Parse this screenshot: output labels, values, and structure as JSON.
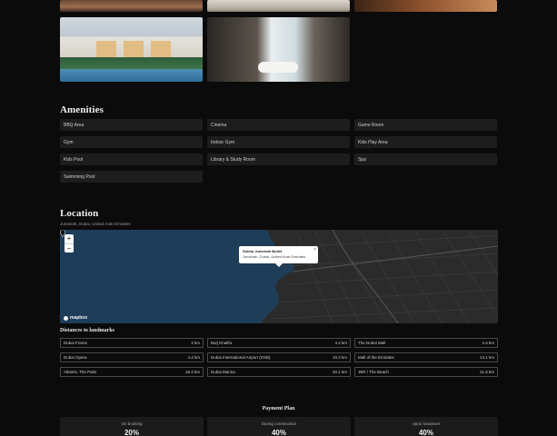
{
  "amenities": {
    "title": "Amenities",
    "items": [
      "BBQ Area",
      "Cinema",
      "Game Room",
      "Gym",
      "Indoor Gym",
      "Kids Play Area",
      "Kids Pool",
      "Library & Study Room",
      "Spa",
      "Swimming Pool"
    ]
  },
  "location": {
    "title": "Location",
    "subtitle": "Jumeirah, Dubai, United Arab Emirates",
    "map": {
      "zoom_in": "+",
      "zoom_out": "−",
      "popup_title": "Sobha Jumeirah Bullet",
      "popup_address": "Jumeirah, Dubai, United Arab Emirates",
      "popup_close": "×",
      "provider": "mapbox",
      "water_color": "#1e3d59",
      "land_color": "#2b2b2b"
    }
  },
  "distances": {
    "title": "Distances to landmarks",
    "items": [
      {
        "name": "Dubai Frame",
        "value": "3 km"
      },
      {
        "name": "Burj Khalifa",
        "value": "4.2 km"
      },
      {
        "name": "The Dubai Mall",
        "value": "4.4 km"
      },
      {
        "name": "Dubai Opera",
        "value": "4.4 km"
      },
      {
        "name": "Dubai International Airport (DXB)",
        "value": "10.3 km"
      },
      {
        "name": "Mall of the Emirates",
        "value": "14.1 km"
      },
      {
        "name": "Atlantis, The Palm",
        "value": "18.4 km"
      },
      {
        "name": "Dubai Marina",
        "value": "20.1 km"
      },
      {
        "name": "JBR / The Beach",
        "value": "21.8 km"
      }
    ]
  },
  "payment": {
    "title": "Payment Plan",
    "stages": [
      {
        "label": "On booking",
        "percent": "20%"
      },
      {
        "label": "During construction",
        "percent": "40%"
      },
      {
        "label": "Upon handover",
        "percent": "40%"
      }
    ]
  }
}
